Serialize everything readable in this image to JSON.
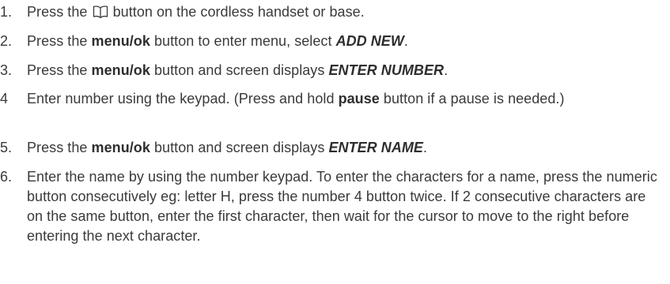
{
  "steps": [
    {
      "number": "1.",
      "parts": {
        "a": "Press the ",
        "icon": "phonebook-icon",
        "b": " button on the cordless handset or base."
      }
    },
    {
      "number": "2.",
      "parts": {
        "a": "Press the ",
        "bold1": "menu/ok",
        "b": " button to enter menu, select ",
        "bi1": "ADD NEW",
        "c": "."
      }
    },
    {
      "number": "3.",
      "parts": {
        "a": "Press the ",
        "bold1": "menu/ok",
        "b": " button and screen displays ",
        "bi1": "ENTER NUMBER",
        "c": "."
      }
    },
    {
      "number": "4",
      "parts": {
        "a": "Enter number using the keypad. (Press and hold ",
        "bold1": "pause",
        "b": " button if a pause is needed.)"
      }
    },
    {
      "number": "5.",
      "parts": {
        "a": "Press the ",
        "bold1": "menu/ok",
        "b": " button and screen displays ",
        "bi1": "ENTER NAME",
        "c": "."
      }
    },
    {
      "number": "6.",
      "parts": {
        "a": "Enter the name by using the number keypad. To enter the characters for a name, press the numeric button consecutively eg: letter H, press the number 4 button twice. If 2 consecutive characters are on the same button, enter the first character, then wait for the cursor to move to the right before entering the next character."
      }
    }
  ]
}
